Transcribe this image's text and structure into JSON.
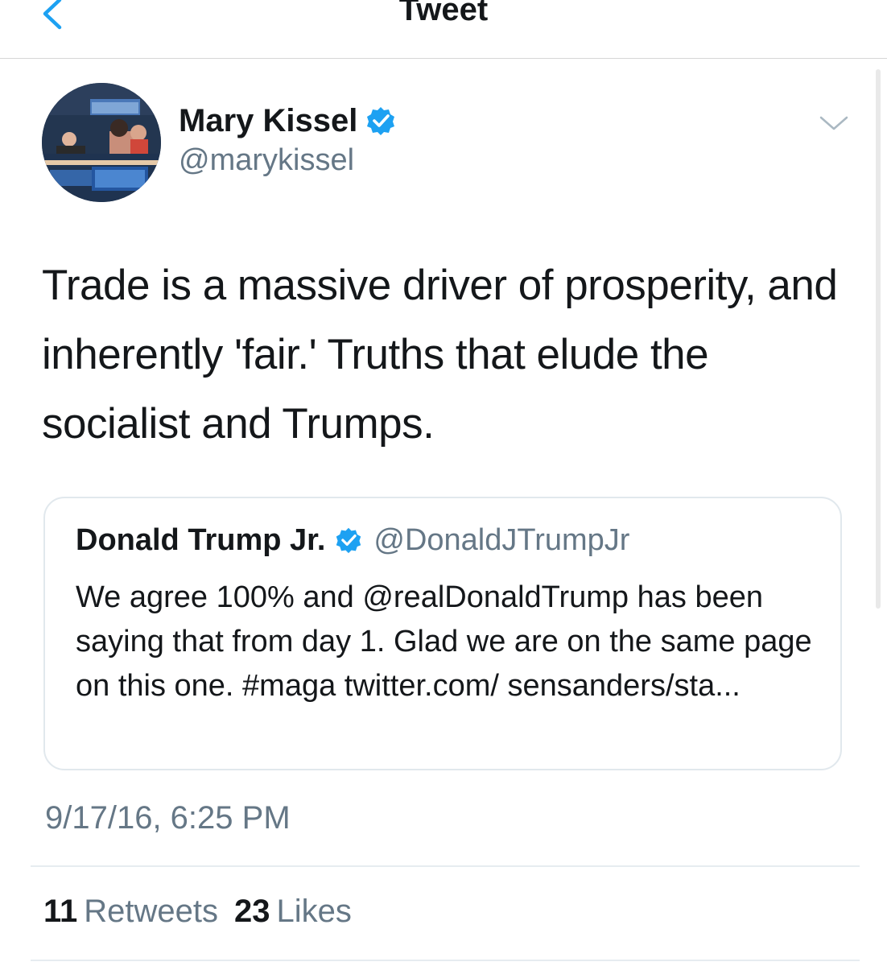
{
  "nav": {
    "title": "Tweet",
    "back_icon": "chevron-left-icon"
  },
  "tweet": {
    "author": {
      "name": "Mary Kissel",
      "handle": "@marykissel",
      "verified": true,
      "avatar_icon": "avatar-photo"
    },
    "menu_icon": "chevron-down-icon",
    "text": "Trade is a massive driver of prosperity, and inherently 'fair.' Truths that elude the socialist and Trumps.",
    "quoted": {
      "author_name": "Donald Trump Jr.",
      "author_handle": "@DonaldJTrumpJr",
      "verified": true,
      "text": "We agree 100% and @realDonaldTrump  has been saying that from day 1. Glad we are on the same page on this one. #maga twitter.com/ sensanders/sta..."
    },
    "timestamp": "9/17/16, 6:25 PM",
    "stats": {
      "retweets_count": "11",
      "retweets_label": "Retweets",
      "likes_count": "23",
      "likes_label": "Likes"
    }
  },
  "colors": {
    "accent": "#1da1f2",
    "text_primary": "#14171a",
    "text_secondary": "#657786",
    "border": "#e1e8ed"
  }
}
